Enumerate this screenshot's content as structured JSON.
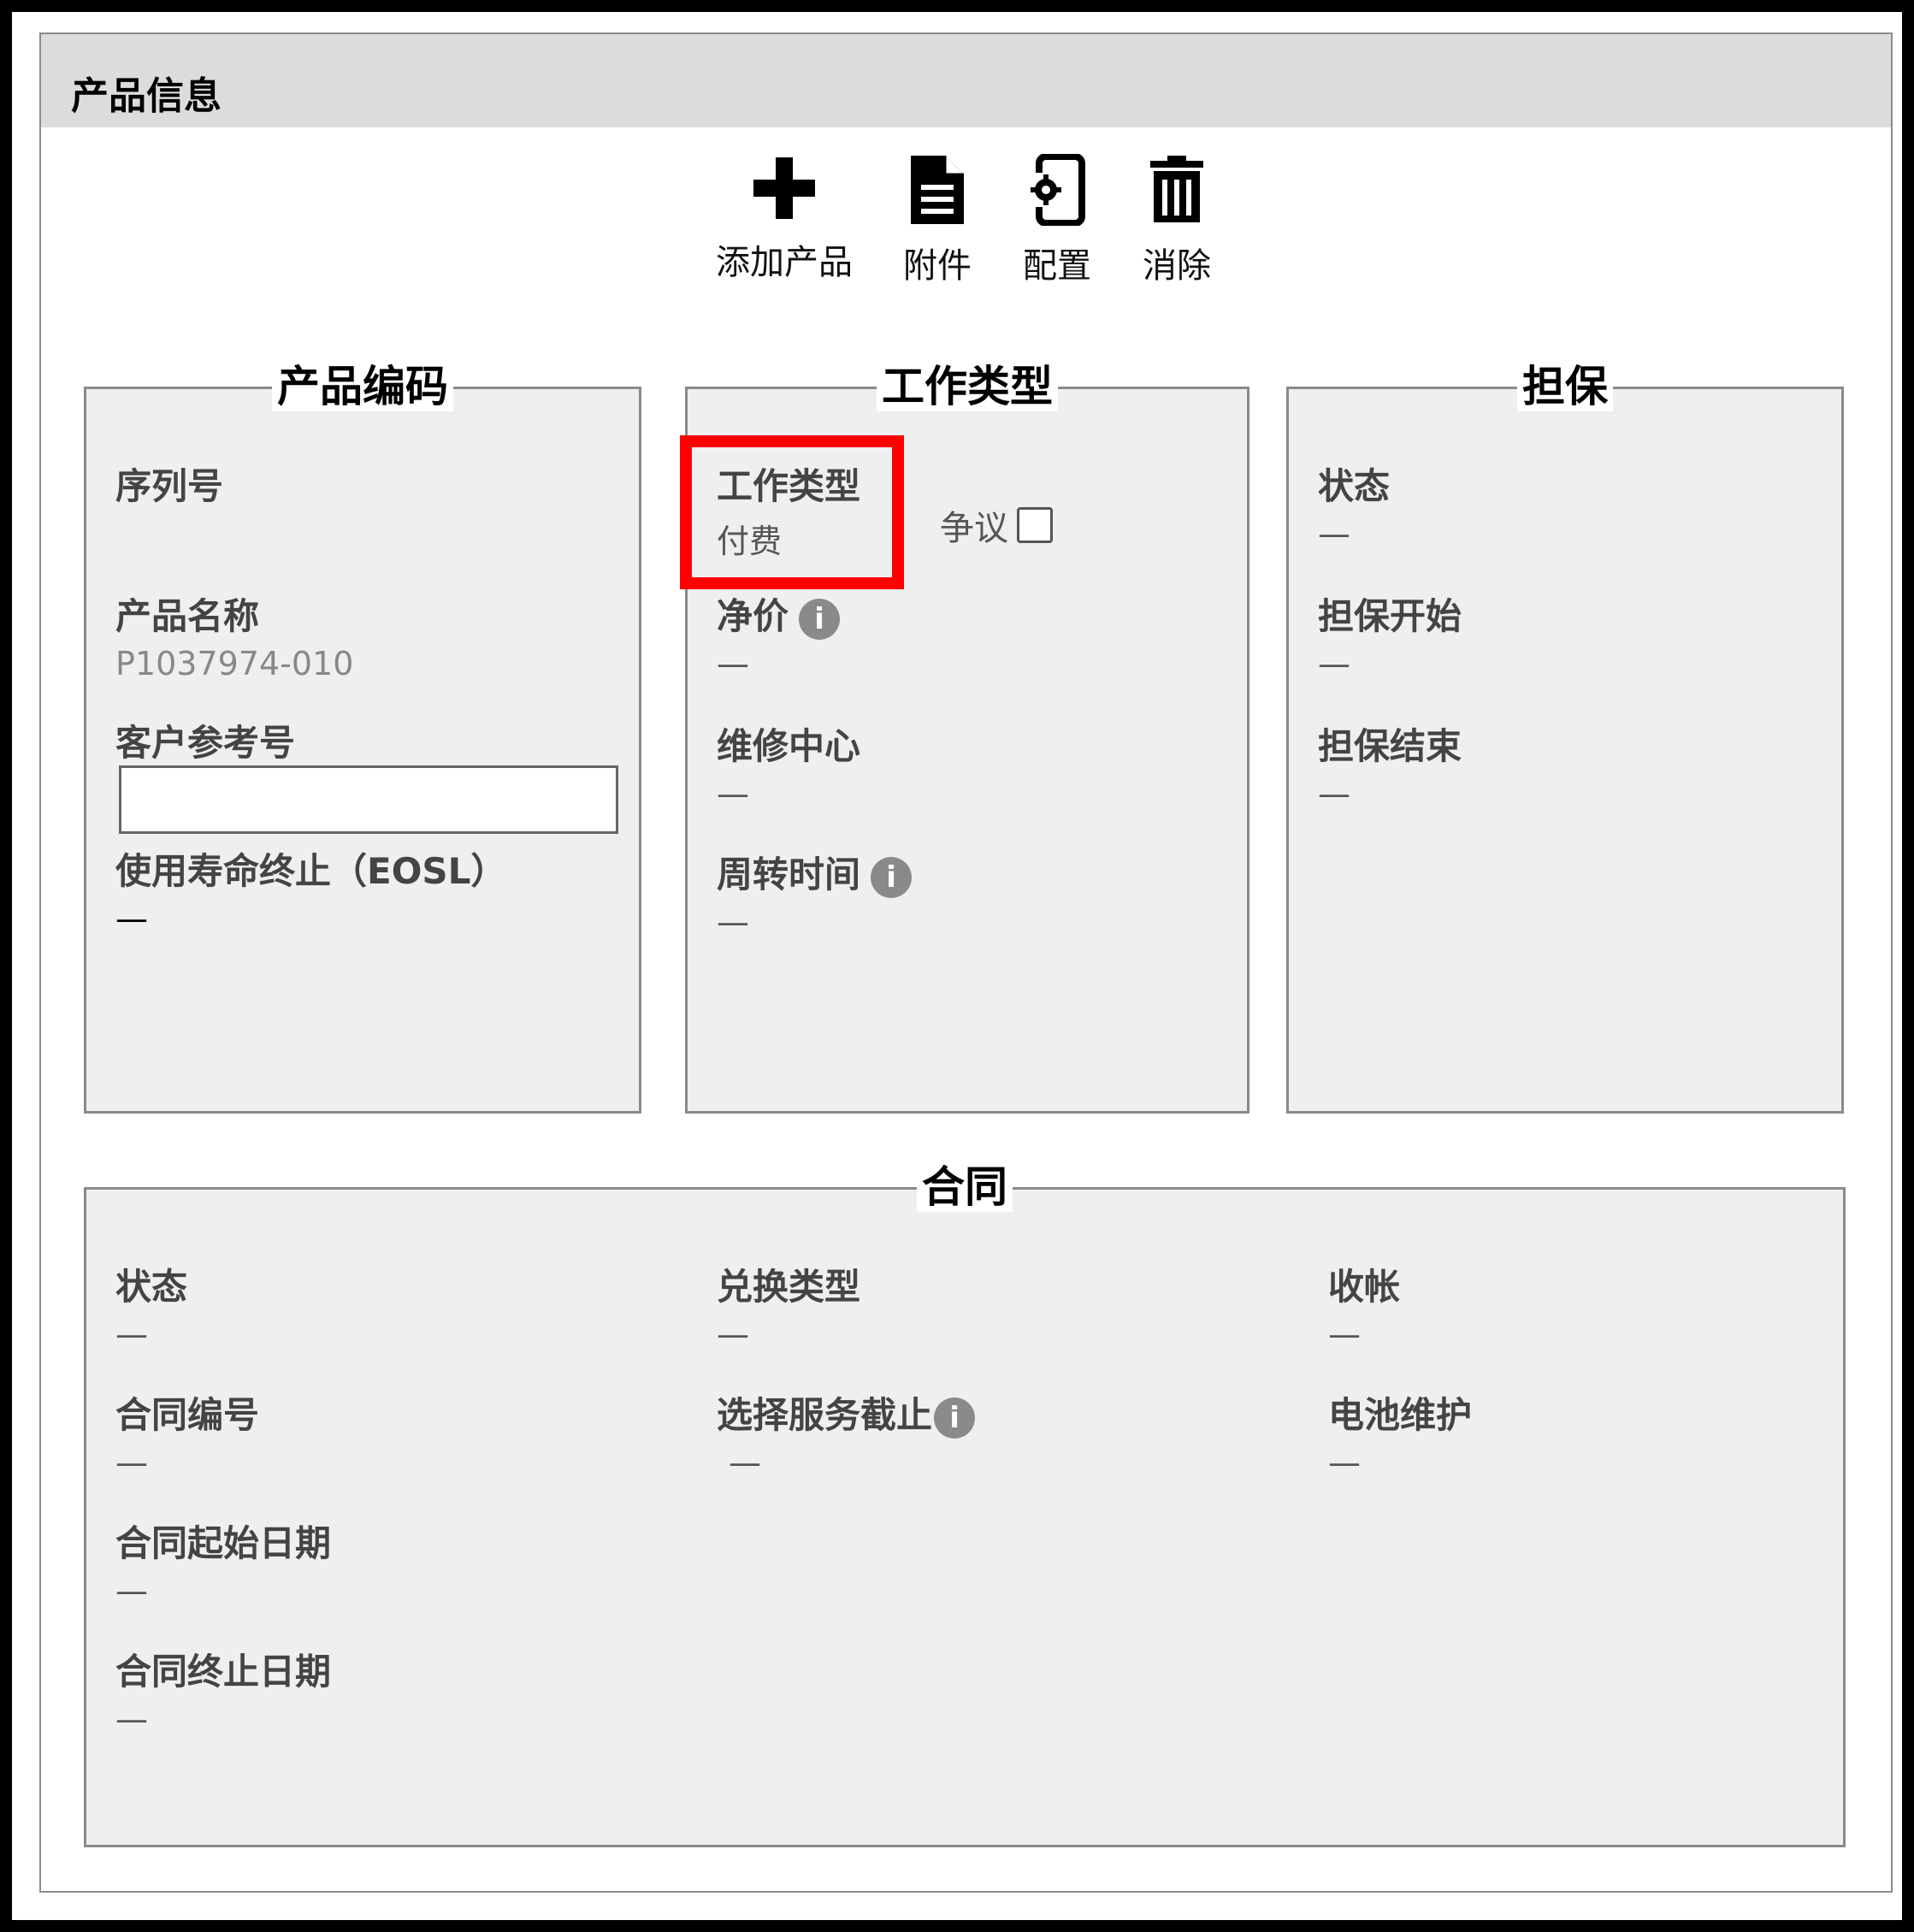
{
  "panel": {
    "title": "产品信息"
  },
  "toolbar": {
    "add_label": "添加产品",
    "attach_label": "附件",
    "config_label": "配置",
    "delete_label": "消除"
  },
  "product": {
    "title": "产品编码",
    "serial_label": "序列号",
    "name_label": "产品名称",
    "name_value": "P1037974-010",
    "ref_label": "客户参考号",
    "ref_value": "",
    "eosl_label": "使用寿命终止（EOSL）",
    "eosl_value": "—"
  },
  "worktype": {
    "title": "工作类型",
    "type_label": "工作类型",
    "type_value": "付费",
    "dispute_label": "争议",
    "dispute_checked": false,
    "net_label": "净价",
    "net_value": "—",
    "repair_label": "维修中心",
    "repair_value": "—",
    "turnaround_label": "周转时间",
    "turnaround_value": "—"
  },
  "warranty": {
    "title": "担保",
    "status_label": "状态",
    "status_value": "—",
    "start_label": "担保开始",
    "start_value": "—",
    "end_label": "担保结束",
    "end_value": "—"
  },
  "contract": {
    "title": "合同",
    "status_label": "状态",
    "status_value": "—",
    "number_label": "合同编号",
    "number_value": "—",
    "start_label": "合同起始日期",
    "start_value": "—",
    "end_label": "合同终止日期",
    "end_value": "—",
    "exchange_label": "兑换类型",
    "exchange_value": "—",
    "optout_label": "选择服务截止",
    "optout_value": "—",
    "billing_label": "收帐",
    "billing_value": "—",
    "battery_label": "电池维护",
    "battery_value": "—"
  },
  "icons": {
    "info": "i",
    "highlight_color": "#ff0000"
  }
}
